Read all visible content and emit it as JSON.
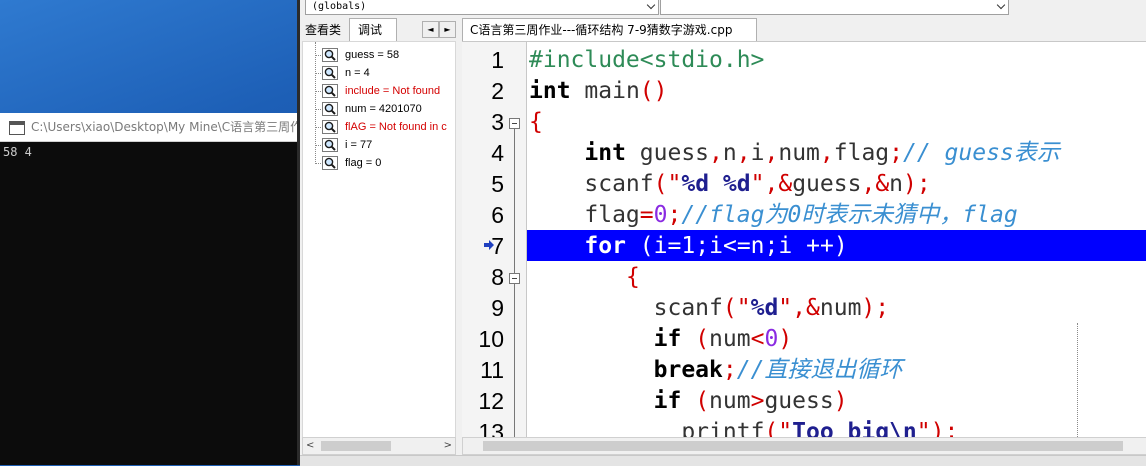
{
  "console": {
    "title": "C:\\Users\\xiao\\Desktop\\My Mine\\C语言第三周作",
    "output": "58 4"
  },
  "toolbar": {
    "scope_select": "(globals)",
    "member_select": ""
  },
  "left_panel": {
    "tabs": [
      "查看类",
      "调试"
    ],
    "active_tab": "调试",
    "nav_prev": "◄",
    "nav_next": "►",
    "watches": [
      {
        "text": "guess = 58",
        "error": false
      },
      {
        "text": "n = 4",
        "error": false
      },
      {
        "text": "include = Not found",
        "error": true
      },
      {
        "text": "num = 4201070",
        "error": false
      },
      {
        "text": "flAG = Not found in c",
        "error": true
      },
      {
        "text": "i = 77",
        "error": false
      },
      {
        "text": "flag = 0",
        "error": false
      }
    ]
  },
  "editor": {
    "tab_title": "C语言第三周作业---循环结构 7-9猜数字游戏.cpp",
    "current_line": 7,
    "line_numbers": [
      "1",
      "2",
      "3",
      "4",
      "5",
      "6",
      "7",
      "8",
      "9",
      "10",
      "11",
      "12",
      "13"
    ],
    "lines": [
      "#include<stdio.h>",
      "int main()",
      "{",
      "    int guess,n,i,num,flag;// guess表示",
      "    scanf(\"%d %d\",&guess,&n);",
      "    flag=0;//flag为0时表示未猜中，flag",
      "    for (i=1;i<=n;i ++)",
      "       {",
      "         scanf(\"%d\",&num);",
      "         if (num<0)",
      "         break;//直接退出循环",
      "         if (num>guess)",
      "           printf(\"Too big\\n\");"
    ]
  },
  "colors": {
    "keyword": "#000000",
    "operator": "#d00000",
    "comment": "#3a8fd1",
    "preprocessor": "#2e8b57",
    "string_format": "#1f1f8f",
    "number": "#8a2be2",
    "current_line_highlight": "#0000ff",
    "watch_error": "#d40000",
    "desktop": "#1f5fb3"
  },
  "icons": {
    "watch_item": "magnifier-watch-icon",
    "exec_pointer": "execution-arrow-icon",
    "console": "console-window-icon"
  }
}
